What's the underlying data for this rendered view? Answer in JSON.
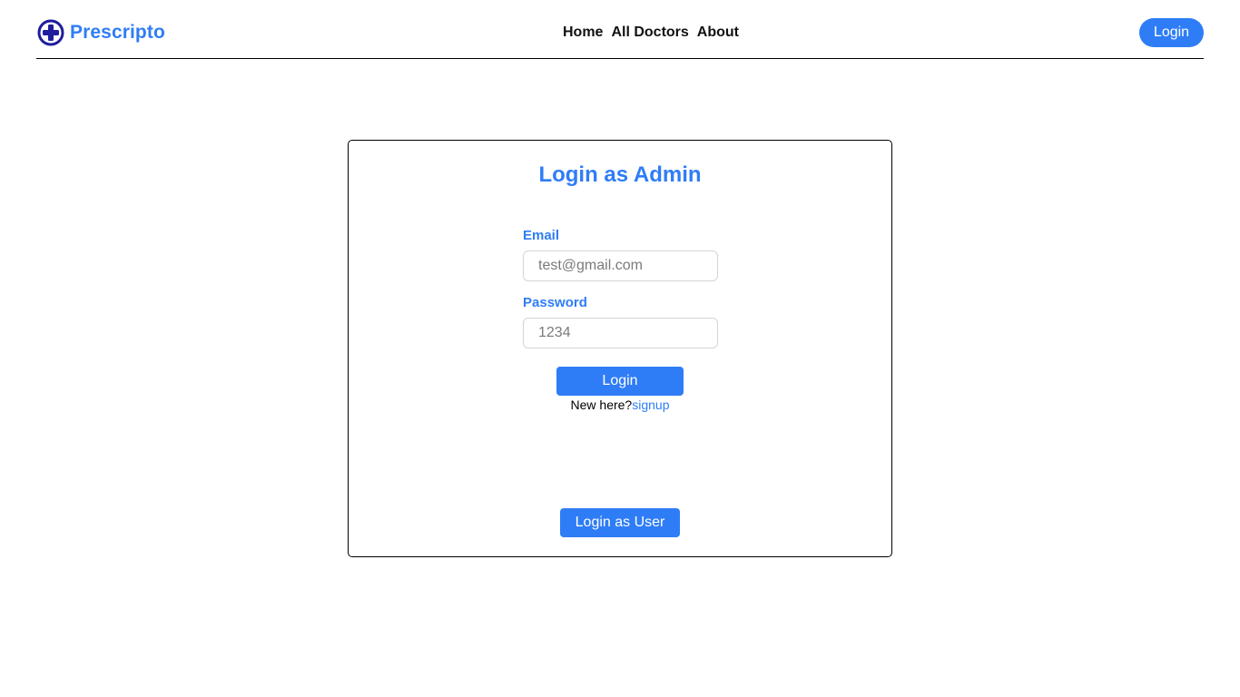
{
  "brand": {
    "name": "Prescripto",
    "icon": "medical-cross-icon",
    "icon_color": "#1d1d9e"
  },
  "nav": {
    "links": [
      {
        "label": "Home"
      },
      {
        "label": "All Doctors"
      },
      {
        "label": "About"
      }
    ],
    "login_label": "Login"
  },
  "login_form": {
    "title": "Login as Admin",
    "email_label": "Email",
    "email_placeholder": "test@gmail.com",
    "password_label": "Password",
    "password_placeholder": "1234",
    "submit_label": "Login",
    "new_here_text": "New here?",
    "signup_link": "signup",
    "switch_label": "Login as User"
  },
  "colors": {
    "accent": "#2f7df6",
    "text": "#111111",
    "border": "#000000",
    "input_border": "#d4d4d4"
  }
}
